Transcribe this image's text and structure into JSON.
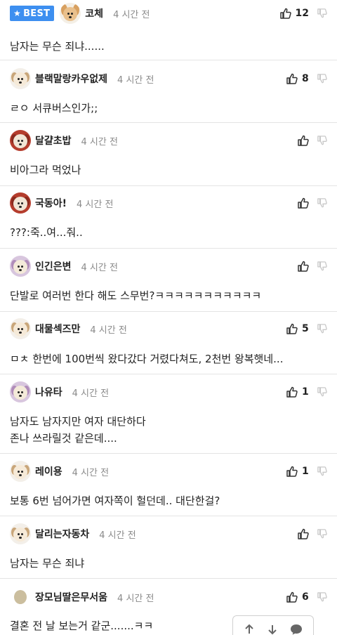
{
  "best_badge": {
    "star": "★",
    "label": "BEST"
  },
  "comments": [
    {
      "nickname": "코체",
      "time": "4 시간 전",
      "count": "12",
      "lines": [
        "남자는 무슨 죄냐......"
      ],
      "avatar": "chihuahua"
    },
    {
      "nickname": "블랙말랑카우없제",
      "time": "4 시간 전",
      "count": "8",
      "lines": [
        "ㄹㅇ 서큐버스인가;;"
      ],
      "avatar": "maltese"
    },
    {
      "nickname": "달걀초밥",
      "time": "4 시간 전",
      "count": "",
      "lines": [
        "비아그라 먹었나"
      ],
      "avatar": "red-dog"
    },
    {
      "nickname": "국동아!",
      "time": "4 시간 전",
      "count": "",
      "lines": [
        "???:죽..여...줘.."
      ],
      "avatar": "red-dog"
    },
    {
      "nickname": "인긴은변",
      "time": "4 시간 전",
      "count": "",
      "lines": [
        "단발로 여러번 한다 해도 스무번?ㅋㅋㅋㅋㅋㅋㅋㅋㅋㅋㅋ"
      ],
      "avatar": "purple-dog"
    },
    {
      "nickname": "대물섹즈만",
      "time": "4 시간 전",
      "count": "5",
      "lines": [
        "ㅁㅊ 한번에 100번씩 왔다갔다 거렸다쳐도, 2천번 왕복햇네..."
      ],
      "avatar": "maltese"
    },
    {
      "nickname": "나유타",
      "time": "4 시간 전",
      "count": "1",
      "lines": [
        "남자도 남자지만 여자 대단하다",
        "존나 쓰라릴것 같은데...."
      ],
      "avatar": "purple-dog"
    },
    {
      "nickname": "레이용",
      "time": "4 시간 전",
      "count": "1",
      "lines": [
        "보통 6번 넘어가면 여자쪽이 헐던데.. 대단한걸?"
      ],
      "avatar": "maltese"
    },
    {
      "nickname": "달리는자동차",
      "time": "4 시간 전",
      "count": "",
      "lines": [
        "남자는 무슨 죄냐"
      ],
      "avatar": "maltese"
    },
    {
      "nickname": "장모님딸은무서움",
      "time": "4 시간 전",
      "count": "6",
      "lines": [
        "결혼 전 날 보는거 같군.......ㅋㅋ"
      ],
      "avatar": "plain"
    }
  ],
  "toolbar": {
    "icons": [
      "arrow-up-icon",
      "arrow-down-icon",
      "comment-bubble-icon"
    ]
  },
  "colors": {
    "best": "#3d8ff0",
    "divider": "#e4e4e4",
    "time": "#8a8a8a"
  }
}
